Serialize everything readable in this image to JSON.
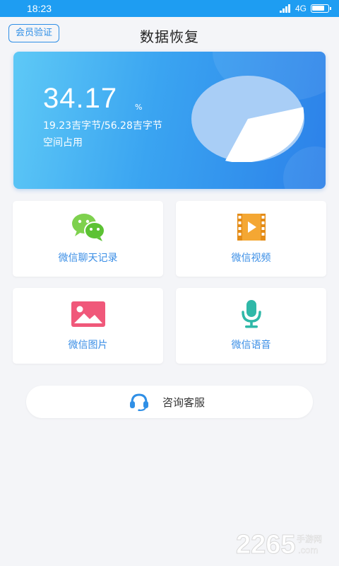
{
  "status_bar": {
    "time": "18:23",
    "network": "4G",
    "battery_level": 0.8
  },
  "header": {
    "title": "数据恢复",
    "vip_label": "会员验证"
  },
  "storage": {
    "percent": "34.17",
    "percent_unit": "%",
    "detail": "19.23吉字节/56.28吉字节",
    "label": "空间占用",
    "used_fraction": 0.3417,
    "colors": {
      "used": "#ffffff",
      "free": "#a9cef6"
    }
  },
  "tiles": [
    {
      "label": "微信聊天记录",
      "icon": "wechat-icon"
    },
    {
      "label": "微信视频",
      "icon": "video-icon"
    },
    {
      "label": "微信图片",
      "icon": "image-icon"
    },
    {
      "label": "微信语音",
      "icon": "microphone-icon"
    }
  ],
  "service": {
    "label": "咨询客服",
    "icon": "headset-icon"
  },
  "watermark": {
    "digits": "2265",
    "suffix": "手游网",
    "domain": ".com"
  },
  "colors": {
    "accent": "#3a8ee6",
    "status_bar": "#1e9df2",
    "background": "#f4f5f8"
  }
}
